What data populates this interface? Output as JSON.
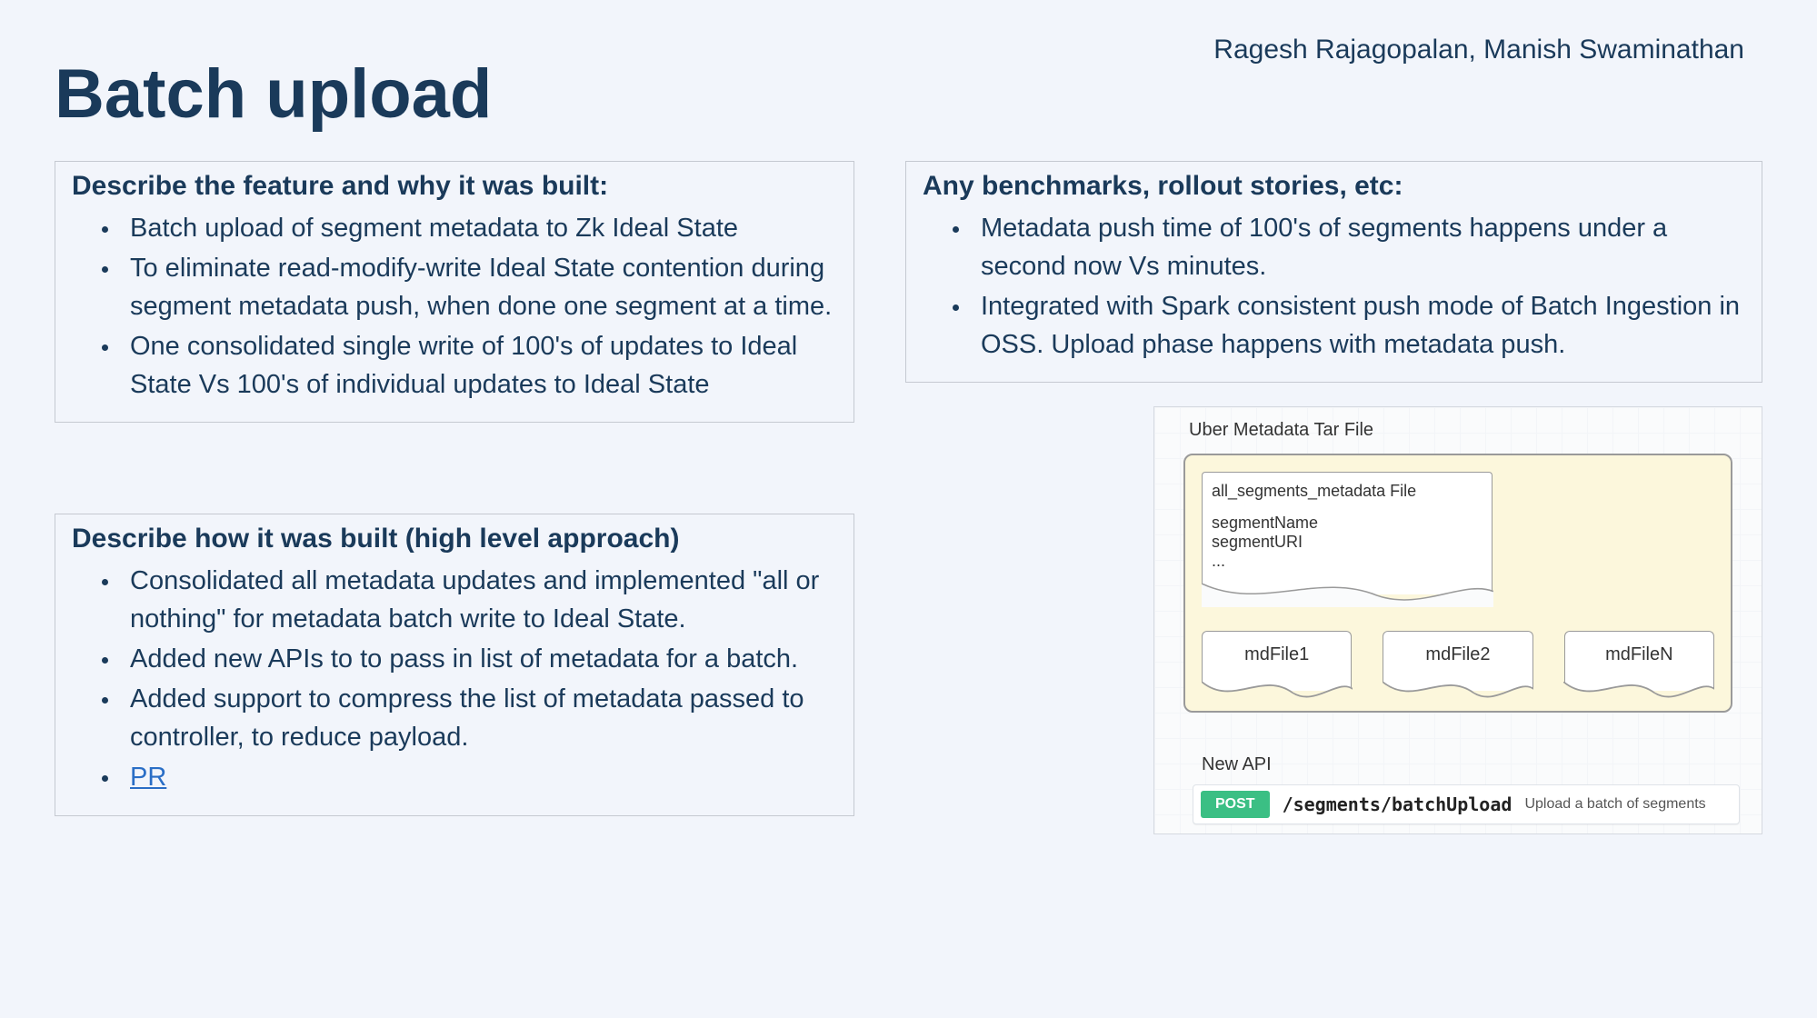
{
  "authors": "Ragesh Rajagopalan, Manish Swaminathan",
  "title": "Batch upload",
  "feature": {
    "heading": "Describe the feature and why it was built:",
    "bullets": [
      "Batch upload of segment metadata to Zk Ideal State",
      "To eliminate read-modify-write Ideal State contention during segment metadata push, when done one segment at a time.",
      "One consolidated single write of 100's of updates to Ideal State Vs 100's of individual updates to Ideal State"
    ]
  },
  "approach": {
    "heading": "Describe how it was built (high level approach)",
    "bullets": [
      "Consolidated all metadata updates and implemented \"all or nothing\" for metadata batch write to Ideal State.",
      "Added new APIs to to pass in list of metadata for a batch.",
      "Added support to compress the list of metadata passed to controller, to reduce payload."
    ],
    "pr_label": "PR"
  },
  "benchmarks": {
    "heading": "Any benchmarks, rollout stories, etc:",
    "bullets": [
      "Metadata push time of 100's of segments happens under a second now Vs minutes.",
      "Integrated with Spark consistent push mode of Batch Ingestion in OSS. Upload phase happens with metadata push."
    ]
  },
  "diagram": {
    "tar_label": "Uber Metadata Tar File",
    "doc_title": "all_segments_metadata File",
    "doc_lines": [
      "segmentName",
      "segmentURI",
      "..."
    ],
    "md_files": [
      "mdFile1",
      "mdFile2",
      "mdFileN"
    ],
    "api_label": "New API",
    "api_method": "POST",
    "api_path": "/segments/batchUpload",
    "api_desc": "Upload a batch of segments"
  }
}
